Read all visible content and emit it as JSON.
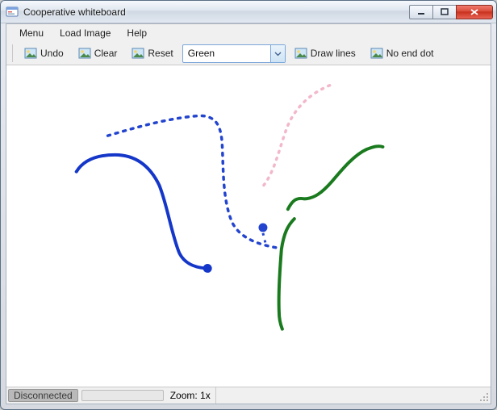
{
  "window": {
    "title": "Cooperative whiteboard"
  },
  "menubar": {
    "items": [
      "Menu",
      "Load Image",
      "Help"
    ]
  },
  "toolbar": {
    "undo": "Undo",
    "clear": "Clear",
    "reset": "Reset",
    "color_selected": "Green",
    "draw_lines": "Draw lines",
    "no_end_dot": "No end dot"
  },
  "statusbar": {
    "connection": "Disconnected",
    "zoom_label": "Zoom:  1x"
  },
  "canvas": {
    "strokes": [
      {
        "id": "blue-solid",
        "color": "#1537c9",
        "style": "solid",
        "has_end_dot": true
      },
      {
        "id": "blue-dotted",
        "color": "#2344cf",
        "style": "dotted",
        "has_end_dot": true
      },
      {
        "id": "pink-dotted",
        "color": "#f2b8ca",
        "style": "dotted",
        "has_end_dot": false
      },
      {
        "id": "green-solid-right",
        "color": "#1a7a1e",
        "style": "solid",
        "has_end_dot": false
      },
      {
        "id": "green-solid-down",
        "color": "#1a7a1e",
        "style": "solid",
        "has_end_dot": false
      }
    ]
  }
}
